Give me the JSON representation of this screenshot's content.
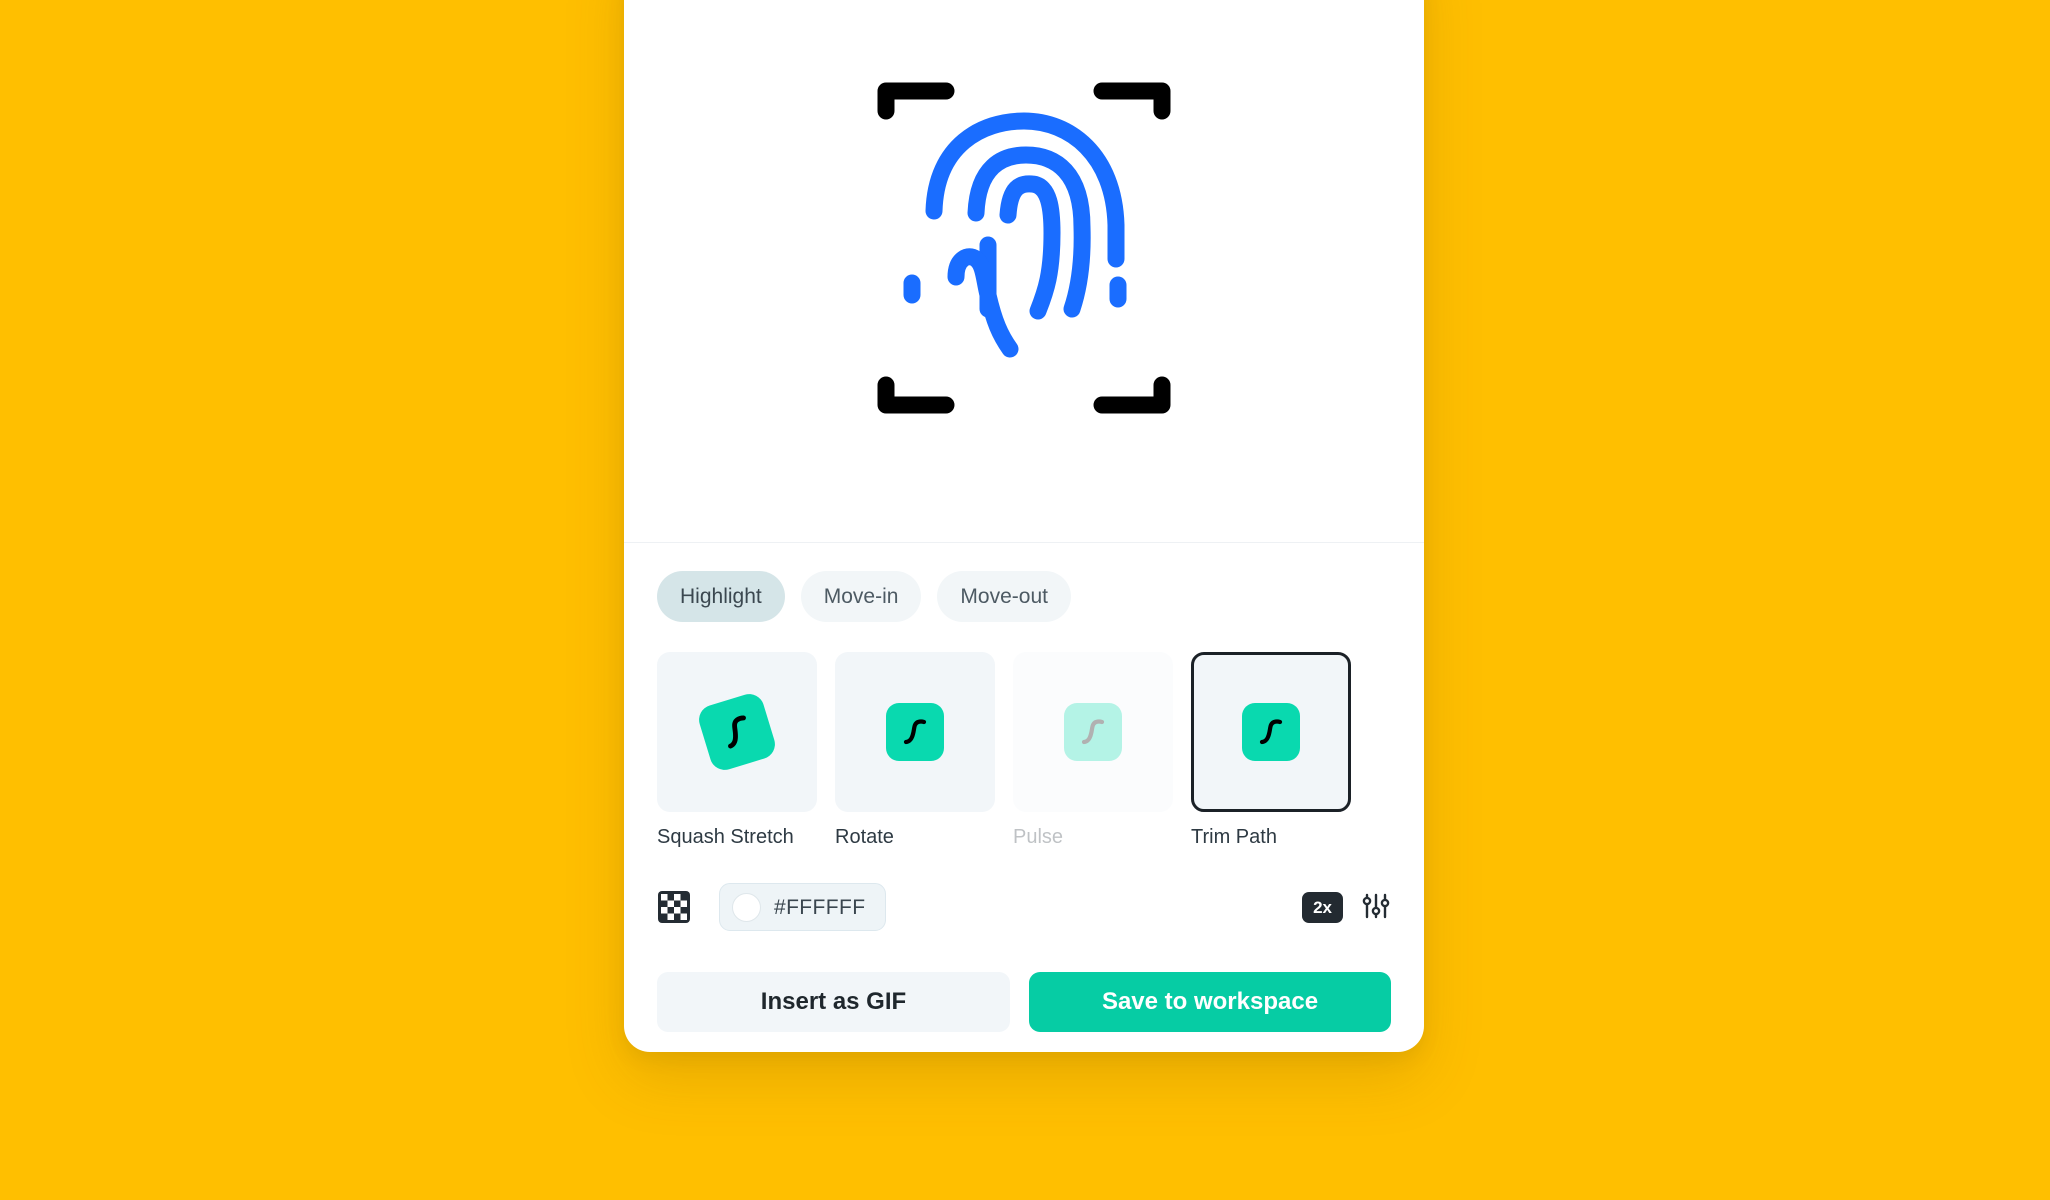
{
  "theme": {
    "background": "#FFBF00",
    "panel_background": "#FFFFFF",
    "accent_teal": "#06CCA4",
    "chip_teal": "#09D9AF",
    "fingerprint_blue": "#1A6DFF",
    "bracket_black": "#000000",
    "selected_border": "#1B2127",
    "tab_active_background": "#D5E5E8",
    "tab_background": "#F2F6F8",
    "card_background": "#F2F6F9",
    "dark_badge": "#232A31"
  },
  "preview": {
    "icon_name": "fingerprint-scan-icon",
    "description": "Blue fingerprint inside black scanner corner brackets"
  },
  "tabs": [
    {
      "label": "Highlight",
      "active": true
    },
    {
      "label": "Move-in",
      "active": false
    },
    {
      "label": "Move-out",
      "active": false
    }
  ],
  "presets": [
    {
      "label": "Squash Stretch",
      "icon": "ease-curve-icon",
      "variant": "rotated",
      "selected": false
    },
    {
      "label": "Rotate",
      "icon": "ease-curve-icon",
      "variant": "normal",
      "selected": false
    },
    {
      "label": "Pulse",
      "icon": "ease-curve-icon",
      "variant": "faded",
      "selected": false
    },
    {
      "label": "Trim Path",
      "icon": "ease-curve-icon",
      "variant": "normal",
      "selected": true
    }
  ],
  "color_row": {
    "checker_icon": "transparent-background-icon",
    "color_value": "#FFFFFF",
    "color_placeholder": "#FFFFFF",
    "swatch_color": "#FFFFFF",
    "speed_badge": "2x",
    "settings_icon": "sliders-icon"
  },
  "actions": {
    "insert_label": "Insert as GIF",
    "save_label": "Save to workspace"
  }
}
